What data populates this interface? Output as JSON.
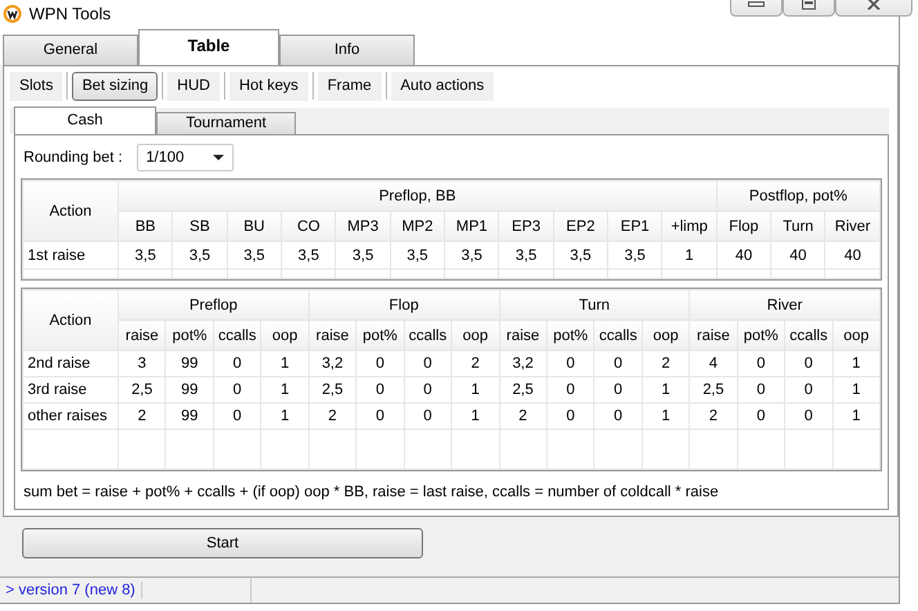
{
  "window": {
    "title": "WPN Tools"
  },
  "main_tabs": [
    {
      "label": "General",
      "selected": false
    },
    {
      "label": "Table",
      "selected": true
    },
    {
      "label": "Info",
      "selected": false
    }
  ],
  "sub_tabs": [
    {
      "label": "Slots",
      "selected": false
    },
    {
      "label": "Bet sizing",
      "selected": true
    },
    {
      "label": "HUD",
      "selected": false
    },
    {
      "label": "Hot keys",
      "selected": false
    },
    {
      "label": "Frame",
      "selected": false
    },
    {
      "label": "Auto actions",
      "selected": false
    }
  ],
  "mode_tabs": [
    {
      "label": "Cash",
      "selected": true
    },
    {
      "label": "Tournament",
      "selected": false
    }
  ],
  "rounding": {
    "label": "Rounding bet :",
    "value": "1/100"
  },
  "first_raise_table": {
    "action_header": "Action",
    "groups": [
      {
        "label": "Preflop, BB",
        "columns": [
          "BB",
          "SB",
          "BU",
          "CO",
          "MP3",
          "MP2",
          "MP1",
          "EP3",
          "EP2",
          "EP1",
          "+limp"
        ]
      },
      {
        "label": "Postflop, pot%",
        "columns": [
          "Flop",
          "Turn",
          "River"
        ]
      }
    ],
    "rows": [
      {
        "action": "1st raise",
        "cells": [
          "3,5",
          "3,5",
          "3,5",
          "3,5",
          "3,5",
          "3,5",
          "3,5",
          "3,5",
          "3,5",
          "3,5",
          "1",
          "40",
          "40",
          "40"
        ]
      }
    ]
  },
  "reraise_table": {
    "action_header": "Action",
    "groups": [
      {
        "label": "Preflop",
        "columns": [
          "raise",
          "pot%",
          "ccalls",
          "oop"
        ]
      },
      {
        "label": "Flop",
        "columns": [
          "raise",
          "pot%",
          "ccalls",
          "oop"
        ]
      },
      {
        "label": "Turn",
        "columns": [
          "raise",
          "pot%",
          "ccalls",
          "oop"
        ]
      },
      {
        "label": "River",
        "columns": [
          "raise",
          "pot%",
          "ccalls",
          "oop"
        ]
      }
    ],
    "rows": [
      {
        "action": "2nd raise",
        "cells": [
          "3",
          "99",
          "0",
          "1",
          "3,2",
          "0",
          "0",
          "2",
          "3,2",
          "0",
          "0",
          "2",
          "4",
          "0",
          "0",
          "1"
        ]
      },
      {
        "action": "3rd raise",
        "cells": [
          "2,5",
          "99",
          "0",
          "1",
          "2,5",
          "0",
          "0",
          "1",
          "2,5",
          "0",
          "0",
          "1",
          "2,5",
          "0",
          "0",
          "1"
        ]
      },
      {
        "action": "other raises",
        "cells": [
          "2",
          "99",
          "0",
          "1",
          "2",
          "0",
          "0",
          "1",
          "2",
          "0",
          "0",
          "1",
          "2",
          "0",
          "0",
          "1"
        ]
      }
    ]
  },
  "note": "sum bet = raise + pot% + ccalls + (if oop) oop * BB,  raise = last raise,  ccalls = number of coldcall * raise",
  "start_button": "Start",
  "status_bar": {
    "version": "> version 7 (new 8)"
  }
}
